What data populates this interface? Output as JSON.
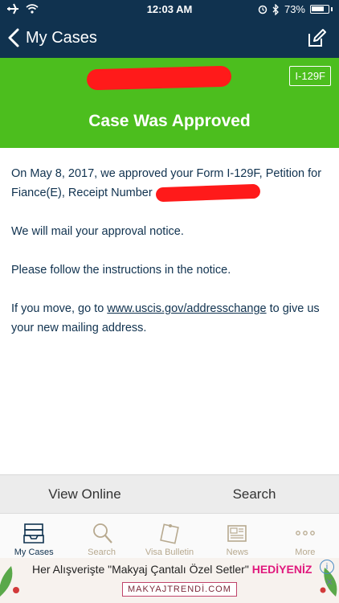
{
  "status_bar": {
    "time": "12:03 AM",
    "battery": "73%",
    "icons": [
      "airplane-icon",
      "wifi-icon",
      "alarm-icon",
      "bluetooth-icon",
      "battery-icon"
    ]
  },
  "nav": {
    "back_label": "My Cases",
    "back_icon": "chevron-left-icon",
    "edit_icon": "edit-icon"
  },
  "case": {
    "form_badge": "I-129F",
    "status_title": "Case Was Approved",
    "header_color": "#4cbe1e"
  },
  "body": {
    "p1_text": "On May 8, 2017, we approved your Form I-129F, Petition for Fiance(E), Receipt Number",
    "p2": "We will mail your approval notice.",
    "p3": "Please follow the instructions in the notice.",
    "p4_before": "If you move, go to ",
    "p4_link": "www.uscis.gov/addresschange",
    "p4_after": " to give us your new mailing address."
  },
  "actions": {
    "view_online": "View Online",
    "search": "Search"
  },
  "tabs": [
    {
      "label": "My Cases",
      "icon": "inbox-tray-icon",
      "active": true
    },
    {
      "label": "Search",
      "icon": "magnifier-icon",
      "active": false
    },
    {
      "label": "Visa Bulletin",
      "icon": "note-pin-icon",
      "active": false
    },
    {
      "label": "News",
      "icon": "newspaper-icon",
      "active": false
    },
    {
      "label": "More",
      "icon": "more-dots-icon",
      "active": false
    }
  ],
  "ad": {
    "headline_plain": "Her Alışverişte \"Makyaj Çantalı Özel Setler\" ",
    "headline_highlight": "HEDİYENİZ",
    "brand": "MAKYAJTRENDİ.COM",
    "info": "i",
    "close": "✕"
  },
  "colors": {
    "navy": "#10324f",
    "approved_green": "#4cbe1e",
    "inactive_tab": "#b7a98f"
  }
}
